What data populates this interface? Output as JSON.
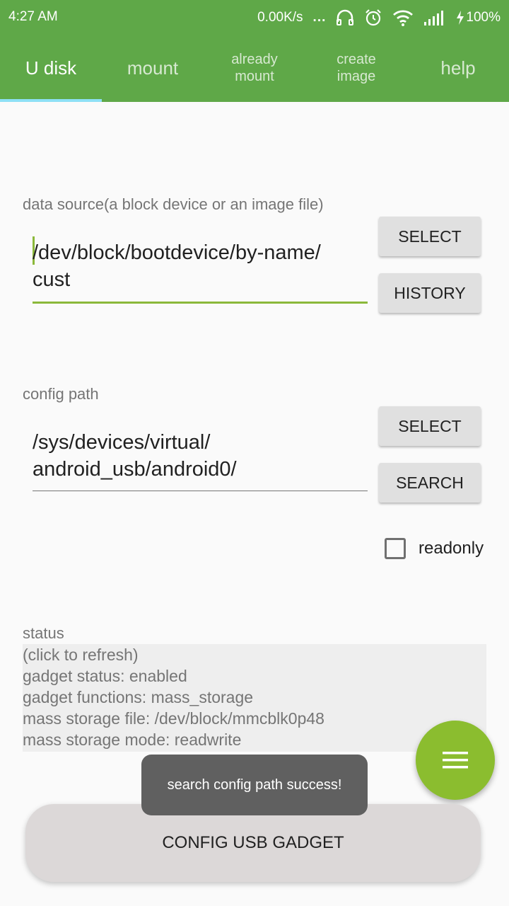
{
  "statusbar": {
    "time": "4:27 AM",
    "speed": "0.00K/s",
    "dots": "...",
    "battery": "100%"
  },
  "tabs": [
    {
      "label": "U disk",
      "active": true
    },
    {
      "label": "mount"
    },
    {
      "label": "already\nmount"
    },
    {
      "label": "create\nimage"
    },
    {
      "label": "help"
    }
  ],
  "data_source": {
    "label": "data source(a block device or an image file)",
    "value": "/dev/block/bootdevice/by-name/\ncust",
    "select_label": "SELECT",
    "history_label": "HISTORY"
  },
  "config_path": {
    "label": "config path",
    "value": "/sys/devices/virtual/\nandroid_usb/android0/",
    "select_label": "SELECT",
    "search_label": "SEARCH"
  },
  "readonly": {
    "label": "readonly",
    "checked": false
  },
  "status": {
    "label": "status",
    "lines": [
      "(click to refresh)",
      "gadget status: enabled",
      "gadget functions: mass_storage",
      "mass storage file: /dev/block/mmcblk0p48",
      "mass storage mode: readwrite"
    ]
  },
  "toast": "search config path success!",
  "config_button": "CONFIG USB GADGET",
  "colors": {
    "primary": "#5fa848",
    "accent": "#8bbd2f",
    "tab_indicator": "#8ee0f5"
  }
}
